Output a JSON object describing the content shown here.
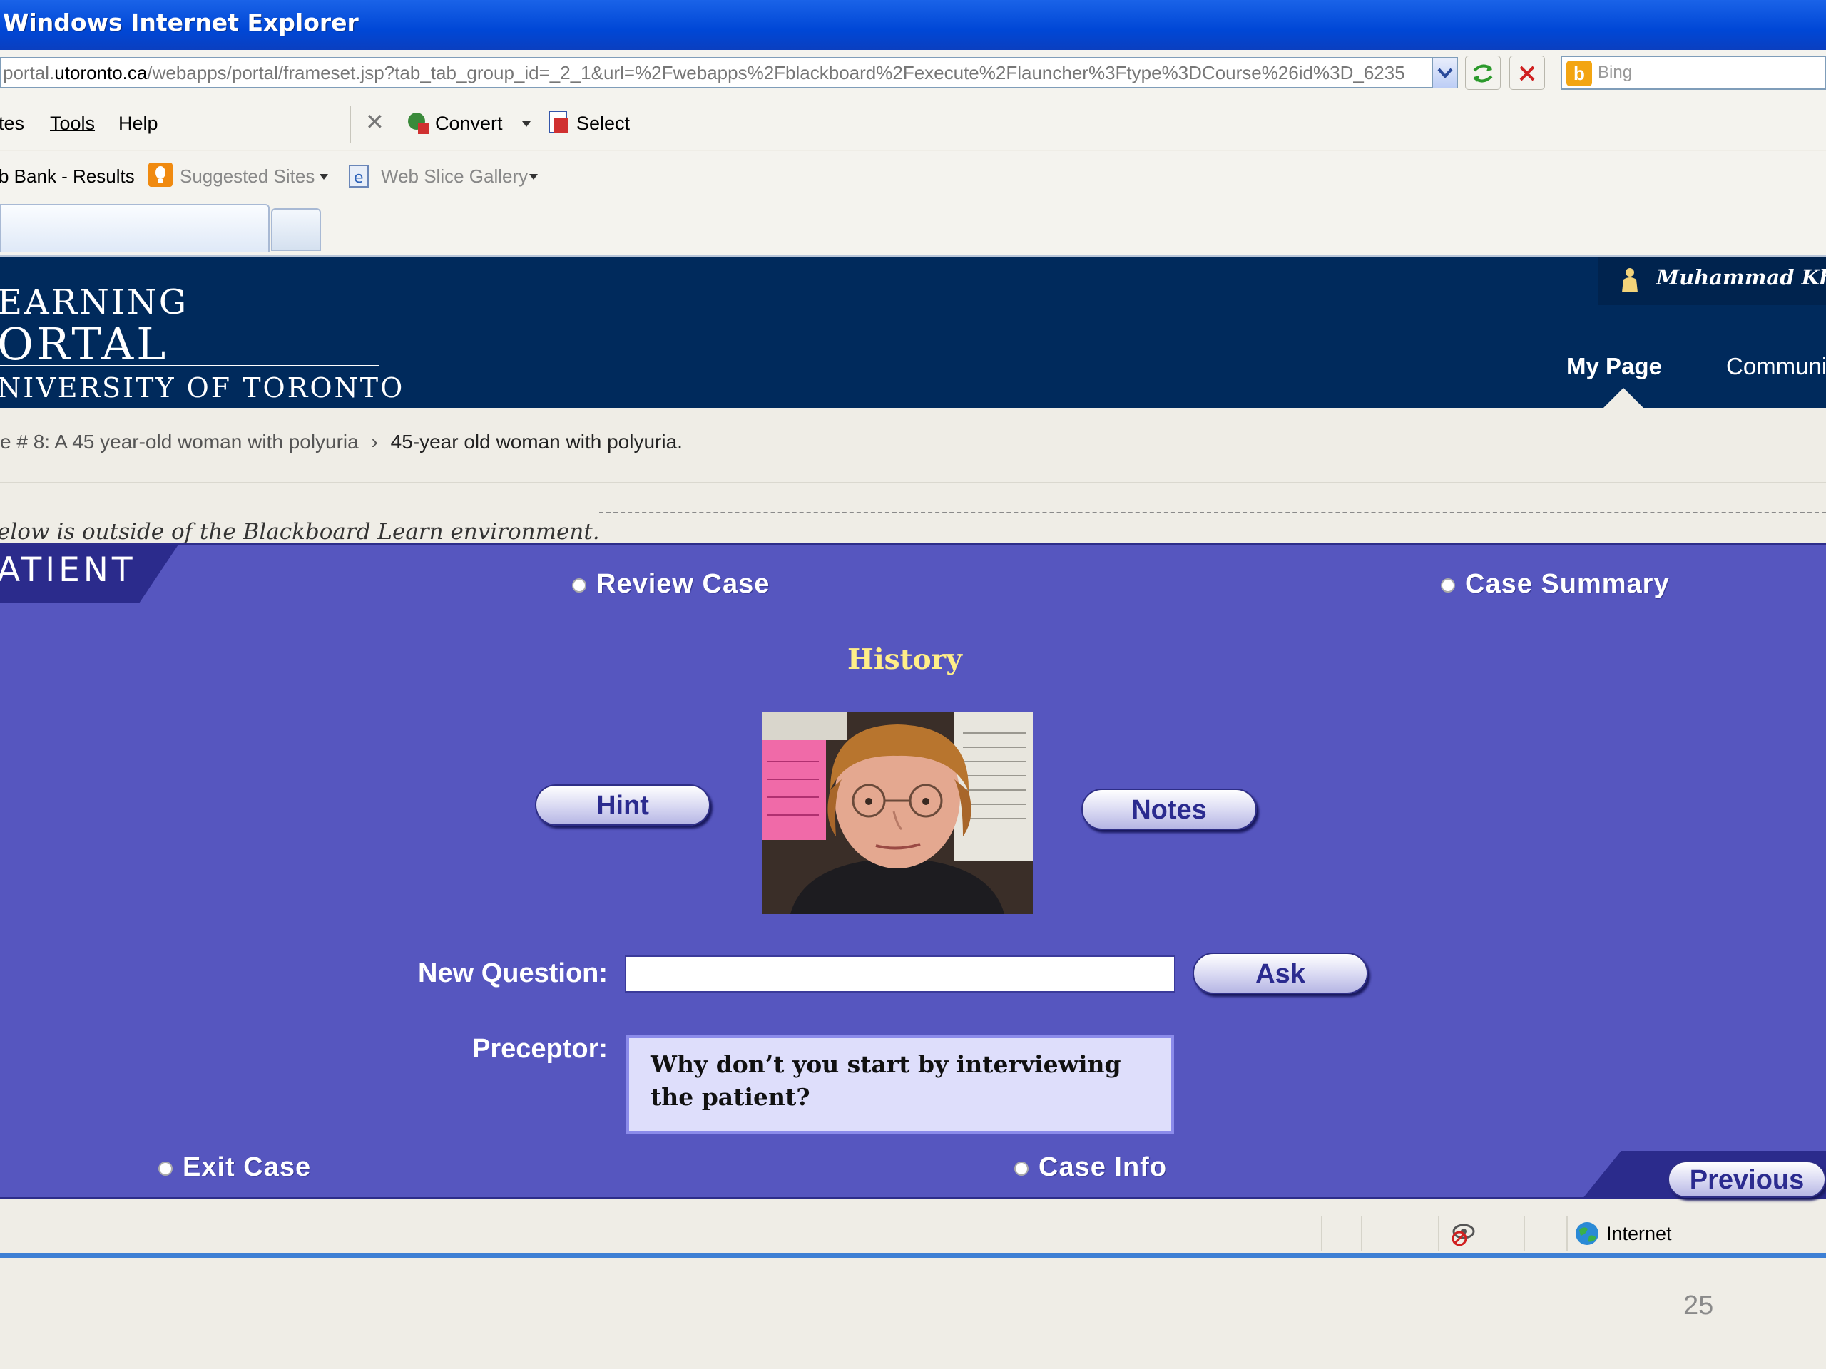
{
  "window": {
    "title": "Windows Internet Explorer"
  },
  "browser": {
    "address": {
      "prefix": "portal.",
      "host": "utoronto.ca",
      "path": "/webapps/portal/frameset.jsp?tab_tab_group_id=_2_1&url=%2Fwebapps%2Fblackboard%2Fexecute%2Flauncher%3Ftype%3DCourse%26id%3D_6235"
    },
    "search_placeholder": "Bing",
    "menu": {
      "favorites_partial": "tes",
      "tools": "Tools",
      "help": "Help",
      "convert": "Convert",
      "select": "Select"
    },
    "favorites": {
      "item1": "b Bank - Results",
      "suggested": "Suggested Sites",
      "webslice": "Web Slice Gallery"
    },
    "status": {
      "zone": "Internet"
    }
  },
  "portal": {
    "logo_line1": "EARNING",
    "logo_line2": "ORTAL",
    "logo_line3": "NIVERSITY OF TORONTO",
    "user": "Muhammad Khan",
    "nav": {
      "my_page": "My Page",
      "community": "Communi"
    },
    "breadcrumb": {
      "parent": "e # 8: A 45 year-old woman with polyuria",
      "separator": "›",
      "current": "45-year old woman with polyuria."
    },
    "notice": "elow is outside of the Blackboard Learn environment."
  },
  "case": {
    "section_tab": "ATIENT",
    "review_case": "Review Case",
    "case_summary": "Case Summary",
    "heading": "History",
    "hint_label": "Hint",
    "notes_label": "Notes",
    "new_question_label": "New Question:",
    "ask_label": "Ask",
    "preceptor_label": "Preceptor:",
    "preceptor_text": "Why don’t you start by interviewing the patient?",
    "exit_case": "Exit Case",
    "case_info": "Case Info",
    "previous_label": "Previous"
  },
  "slide": {
    "page_number": "25"
  },
  "colors": {
    "title_bar": "#0047d6",
    "portal_header": "#002a5c",
    "app_bg": "#5656bf",
    "history_heading": "#ffee88"
  }
}
